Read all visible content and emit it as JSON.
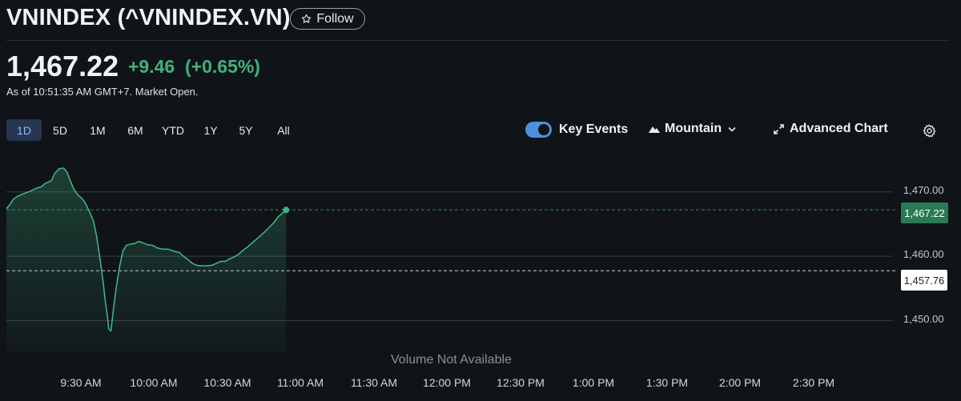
{
  "header": {
    "title": "VNINDEX (^VNINDEX.VN)",
    "follow_label": "Follow",
    "follow_icon": "star-outline-icon"
  },
  "quote": {
    "price": "1,467.22",
    "change": "+9.46",
    "change_pct": "(+0.65%)",
    "as_of": "As of 10:51:35 AM GMT+7. Market Open.",
    "colors": {
      "up": "#3fb27f"
    }
  },
  "toolbar": {
    "ranges": [
      "1D",
      "5D",
      "1M",
      "6M",
      "YTD",
      "1Y",
      "5Y",
      "All"
    ],
    "active_range": "1D",
    "key_events_label": "Key Events",
    "key_events_on": true,
    "chart_style_label": "Mountain",
    "advanced_chart_label": "Advanced Chart",
    "icons": {
      "mountain": "mountain-icon",
      "chevron": "chevron-down-icon",
      "expand": "expand-icon",
      "settings": "gear-icon"
    }
  },
  "chart_data": {
    "type": "area",
    "x_ticks": [
      "9:30 AM",
      "10:00 AM",
      "10:30 AM",
      "11:00 AM",
      "11:30 AM",
      "12:00 PM",
      "12:30 PM",
      "1:00 PM",
      "1:30 PM",
      "2:00 PM",
      "2:30 PM"
    ],
    "y_ticks": [
      "1,470.00",
      "1,460.00",
      "1,450.00"
    ],
    "y_tick_values": [
      1470,
      1460,
      1450
    ],
    "ylim": [
      1445.1,
      1473.7
    ],
    "time_range_minutes": [
      0,
      360
    ],
    "current_price_label": "1,467.22",
    "current_price": 1467.22,
    "previous_close_label": "1,457.76",
    "previous_close": 1457.76,
    "volume_note": "Volume Not Available",
    "series": [
      {
        "color": "#3fb27f",
        "points": [
          [
            0,
            1467.4
          ],
          [
            1.4,
            1468.0
          ],
          [
            2.7,
            1468.8
          ],
          [
            4.5,
            1469.3
          ],
          [
            6.8,
            1469.7
          ],
          [
            9.0,
            1470.0
          ],
          [
            10.8,
            1470.3
          ],
          [
            12.6,
            1470.6
          ],
          [
            14.4,
            1470.8
          ],
          [
            15.8,
            1471.3
          ],
          [
            17.1,
            1471.5
          ],
          [
            18.5,
            1471.8
          ],
          [
            19.8,
            1472.9
          ],
          [
            21.6,
            1473.6
          ],
          [
            23.4,
            1473.7
          ],
          [
            24.8,
            1473.1
          ],
          [
            26.1,
            1471.8
          ],
          [
            27.5,
            1470.5
          ],
          [
            29.3,
            1469.5
          ],
          [
            31.1,
            1468.9
          ],
          [
            32.4,
            1468.2
          ],
          [
            33.8,
            1467.1
          ],
          [
            35.6,
            1465.5
          ],
          [
            36.9,
            1463.2
          ],
          [
            38.3,
            1459.7
          ],
          [
            39.6,
            1456.0
          ],
          [
            40.5,
            1453.0
          ],
          [
            41.4,
            1450.5
          ],
          [
            41.9,
            1448.7
          ],
          [
            42.8,
            1448.4
          ],
          [
            43.7,
            1451.4
          ],
          [
            45.0,
            1455.3
          ],
          [
            46.4,
            1458.5
          ],
          [
            47.7,
            1460.8
          ],
          [
            49.1,
            1461.7
          ],
          [
            50.9,
            1461.9
          ],
          [
            52.7,
            1462.0
          ],
          [
            54.0,
            1462.3
          ],
          [
            55.8,
            1462.1
          ],
          [
            57.6,
            1461.8
          ],
          [
            59.9,
            1461.7
          ],
          [
            61.7,
            1461.3
          ],
          [
            63.9,
            1461.1
          ],
          [
            66.2,
            1461.1
          ],
          [
            68.4,
            1460.8
          ],
          [
            70.7,
            1460.6
          ],
          [
            72.5,
            1460.0
          ],
          [
            74.3,
            1459.5
          ],
          [
            76.1,
            1458.9
          ],
          [
            77.9,
            1458.6
          ],
          [
            79.7,
            1458.5
          ],
          [
            82.0,
            1458.5
          ],
          [
            84.2,
            1458.6
          ],
          [
            86.0,
            1458.9
          ],
          [
            87.8,
            1459.2
          ],
          [
            89.6,
            1459.2
          ],
          [
            91.4,
            1459.6
          ],
          [
            93.2,
            1459.9
          ],
          [
            95.0,
            1460.3
          ],
          [
            96.8,
            1460.9
          ],
          [
            98.6,
            1461.4
          ],
          [
            100.4,
            1462.0
          ],
          [
            102.2,
            1462.6
          ],
          [
            104.0,
            1463.2
          ],
          [
            105.8,
            1463.8
          ],
          [
            107.6,
            1464.5
          ],
          [
            109.4,
            1465.2
          ],
          [
            111.2,
            1466.1
          ],
          [
            113.0,
            1466.7
          ],
          [
            114.5,
            1467.2
          ]
        ]
      }
    ]
  }
}
